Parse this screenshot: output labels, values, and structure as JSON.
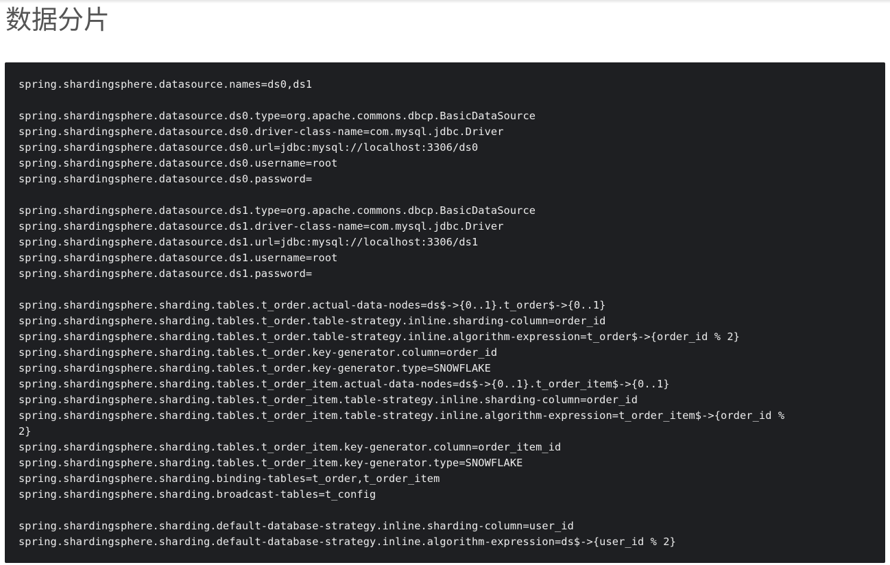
{
  "page": {
    "title": "数据分片"
  },
  "code": {
    "language": "properties",
    "lines": [
      "spring.shardingsphere.datasource.names=ds0,ds1",
      "",
      "spring.shardingsphere.datasource.ds0.type=org.apache.commons.dbcp.BasicDataSource",
      "spring.shardingsphere.datasource.ds0.driver-class-name=com.mysql.jdbc.Driver",
      "spring.shardingsphere.datasource.ds0.url=jdbc:mysql://localhost:3306/ds0",
      "spring.shardingsphere.datasource.ds0.username=root",
      "spring.shardingsphere.datasource.ds0.password=",
      "",
      "spring.shardingsphere.datasource.ds1.type=org.apache.commons.dbcp.BasicDataSource",
      "spring.shardingsphere.datasource.ds1.driver-class-name=com.mysql.jdbc.Driver",
      "spring.shardingsphere.datasource.ds1.url=jdbc:mysql://localhost:3306/ds1",
      "spring.shardingsphere.datasource.ds1.username=root",
      "spring.shardingsphere.datasource.ds1.password=",
      "",
      "spring.shardingsphere.sharding.tables.t_order.actual-data-nodes=ds$->{0..1}.t_order$->{0..1}",
      "spring.shardingsphere.sharding.tables.t_order.table-strategy.inline.sharding-column=order_id",
      "spring.shardingsphere.sharding.tables.t_order.table-strategy.inline.algorithm-expression=t_order$->{order_id % 2}",
      "spring.shardingsphere.sharding.tables.t_order.key-generator.column=order_id",
      "spring.shardingsphere.sharding.tables.t_order.key-generator.type=SNOWFLAKE",
      "spring.shardingsphere.sharding.tables.t_order_item.actual-data-nodes=ds$->{0..1}.t_order_item$->{0..1}",
      "spring.shardingsphere.sharding.tables.t_order_item.table-strategy.inline.sharding-column=order_id",
      "spring.shardingsphere.sharding.tables.t_order_item.table-strategy.inline.algorithm-expression=t_order_item$->{order_id %",
      "2}",
      "spring.shardingsphere.sharding.tables.t_order_item.key-generator.column=order_item_id",
      "spring.shardingsphere.sharding.tables.t_order_item.key-generator.type=SNOWFLAKE",
      "spring.shardingsphere.sharding.binding-tables=t_order,t_order_item",
      "spring.shardingsphere.sharding.broadcast-tables=t_config",
      "",
      "spring.shardingsphere.sharding.default-database-strategy.inline.sharding-column=user_id",
      "spring.shardingsphere.sharding.default-database-strategy.inline.algorithm-expression=ds$->{user_id % 2}"
    ]
  },
  "colors": {
    "code_background": "#1e1f22",
    "code_text": "#ececec",
    "title_text": "#555555",
    "page_background": "#ffffff"
  }
}
